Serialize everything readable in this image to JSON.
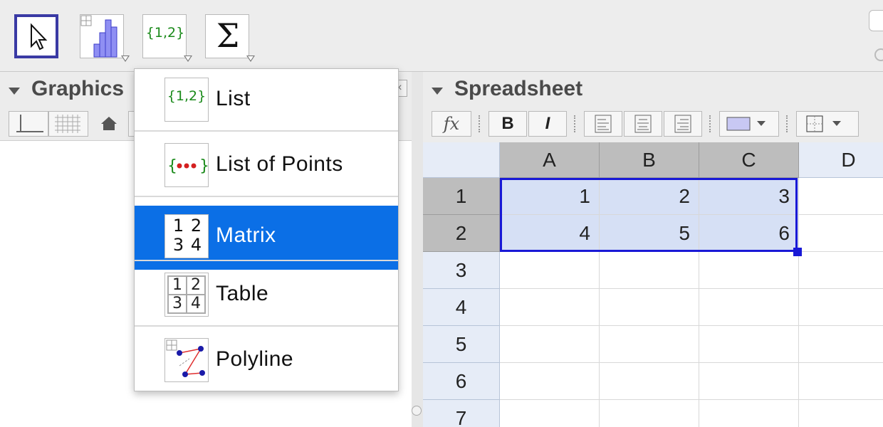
{
  "toolbar": {
    "list_tool_icon_text": "{1,2}"
  },
  "graphics": {
    "title": "Graphics"
  },
  "spreadsheet": {
    "title": "Spreadsheet",
    "style": {
      "fx": "fx",
      "bold": "B",
      "italic": "I"
    },
    "columns": [
      "A",
      "B",
      "C",
      "D"
    ],
    "rows": [
      "1",
      "2",
      "3",
      "4",
      "5",
      "6",
      "7"
    ],
    "cells": [
      [
        "1",
        "2",
        "3"
      ],
      [
        "4",
        "5",
        "6"
      ]
    ]
  },
  "menu": {
    "items": [
      {
        "label": "List",
        "icon": "{1,2}"
      },
      {
        "label": "List of Points"
      },
      {
        "label": "Matrix",
        "icon": [
          "1",
          "2",
          "3",
          "4"
        ]
      },
      {
        "label": "Table",
        "icon": [
          "1",
          "2",
          "3",
          "4"
        ]
      },
      {
        "label": "Polyline"
      }
    ],
    "active_index": 2
  },
  "colors": {
    "selection_blue": "#1919d6",
    "menu_highlight": "#0b6fe6",
    "list_green": "#1a8a1a"
  }
}
